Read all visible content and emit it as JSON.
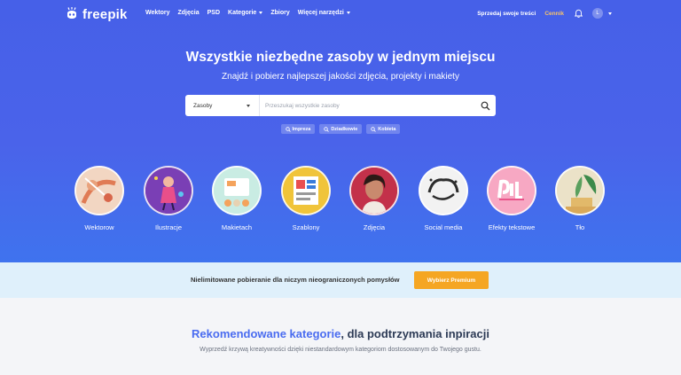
{
  "brand": {
    "name": "freepik"
  },
  "nav": {
    "links": [
      "Wektory",
      "Zdjęcia",
      "PSD",
      "Kategorie",
      "Zbiory",
      "Więcej narzędzi"
    ],
    "sell_label": "Sprzedaj swoje treści",
    "pricing_label": "Cennik",
    "avatar_initial": "L"
  },
  "hero": {
    "title": "Wszystkie niezbędne zasoby w jednym miejscu",
    "subtitle": "Znajdź i pobierz najlepszej jakości zdjęcia, projekty i makiety"
  },
  "search": {
    "type_label": "Zasoby",
    "placeholder": "Przeszukaj wszystkie zasoby"
  },
  "tags": [
    "Imprezа",
    "Dziadkowie",
    "Kobieta"
  ],
  "categories": [
    "Wektorow",
    "Ilustracje",
    "Makietach",
    "Szablony",
    "Zdjęcia",
    "Social media",
    "Efekty tekstowe",
    "Tło"
  ],
  "banner": {
    "text": "Nielimitowane pobieranie dla niczym nieograniczonych pomysłów",
    "button": "Wybierz Premium"
  },
  "recommended": {
    "title_accent": "Rekomendowane kategorie",
    "title_rest": ", dla podtrzymania inpiracji",
    "subtitle": "Wyprzedź krzywą kreatywności dzięki niestandardowym kategoriom dostosowanym do Twojego gustu."
  },
  "colors": {
    "hero": "#4660e8",
    "premium": "#f5a623",
    "banner": "#dff0fb",
    "accent": "#4a6cf0"
  }
}
